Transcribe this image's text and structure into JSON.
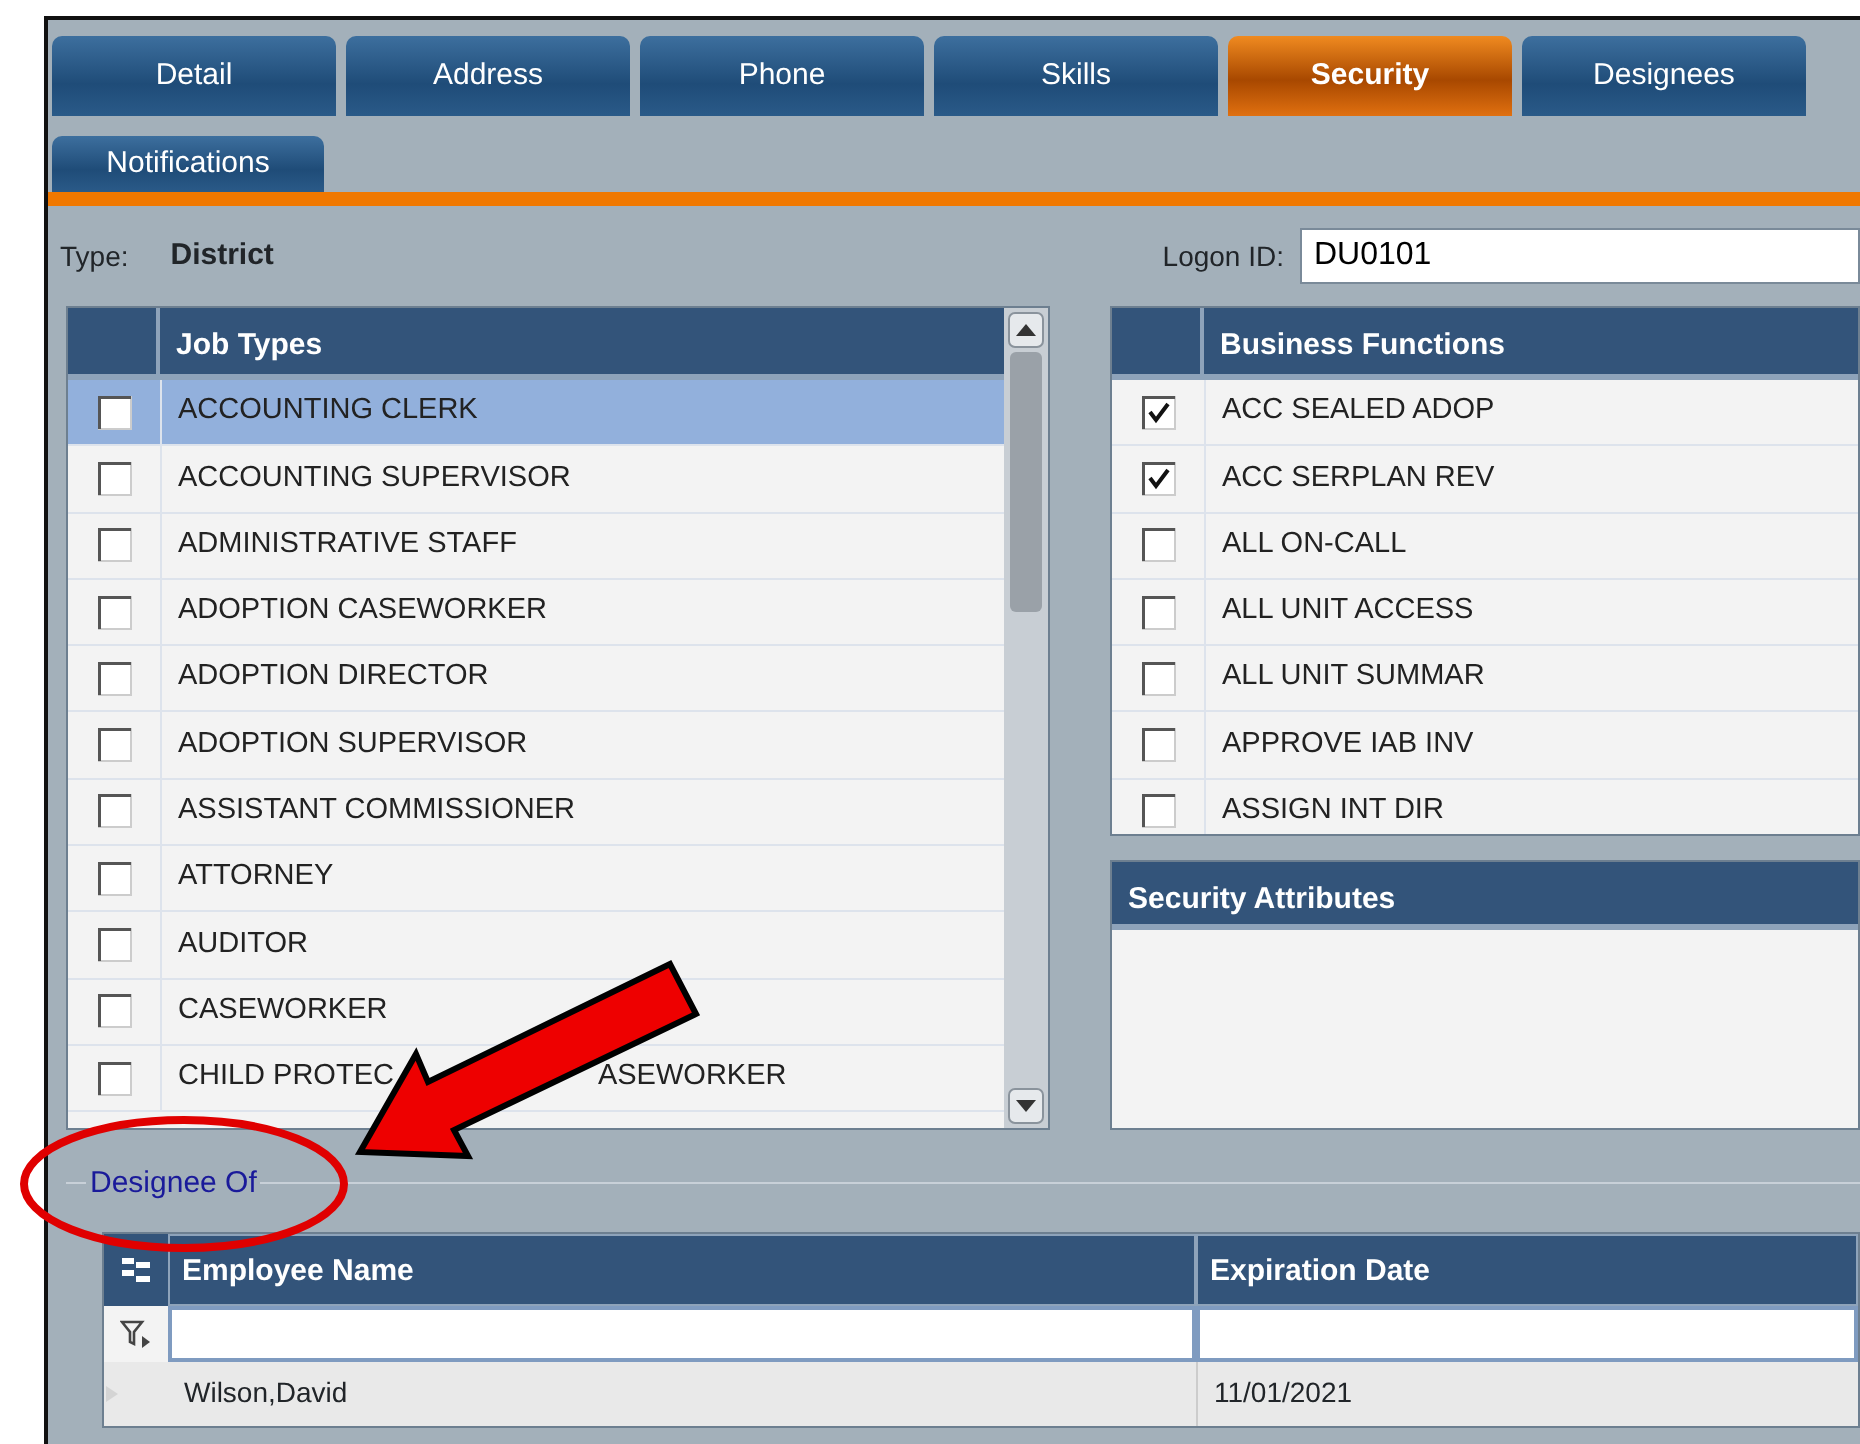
{
  "tabs": [
    {
      "label": "Detail",
      "selected": false
    },
    {
      "label": "Address",
      "selected": false
    },
    {
      "label": "Phone",
      "selected": false
    },
    {
      "label": "Skills",
      "selected": false
    },
    {
      "label": "Security",
      "selected": true
    },
    {
      "label": "Designees",
      "selected": false
    }
  ],
  "tabs_second_row": [
    {
      "label": "Notifications",
      "selected": false
    }
  ],
  "type_label": "Type:",
  "type_value": "District",
  "logon_label": "Logon ID:",
  "logon_id": "DU0101",
  "job_types": {
    "header": "Job Types",
    "rows": [
      {
        "label": "ACCOUNTING CLERK",
        "checked": false,
        "selected": true
      },
      {
        "label": "ACCOUNTING SUPERVISOR",
        "checked": false,
        "selected": false
      },
      {
        "label": "ADMINISTRATIVE STAFF",
        "checked": false,
        "selected": false
      },
      {
        "label": "ADOPTION CASEWORKER",
        "checked": false,
        "selected": false
      },
      {
        "label": "ADOPTION DIRECTOR",
        "checked": false,
        "selected": false
      },
      {
        "label": "ADOPTION SUPERVISOR",
        "checked": false,
        "selected": false
      },
      {
        "label": "ASSISTANT COMMISSIONER",
        "checked": false,
        "selected": false
      },
      {
        "label": "ATTORNEY",
        "checked": false,
        "selected": false
      },
      {
        "label": "AUDITOR",
        "checked": false,
        "selected": false
      },
      {
        "label": "CASEWORKER",
        "checked": false,
        "selected": false
      },
      {
        "label": "CHILD PROTEC",
        "label_continued": "ASEWORKER",
        "checked": false,
        "selected": false
      }
    ]
  },
  "business_functions": {
    "header": "Business Functions",
    "rows": [
      {
        "label": "ACC SEALED ADOP",
        "checked": true
      },
      {
        "label": "ACC SERPLAN REV",
        "checked": true
      },
      {
        "label": "ALL ON-CALL",
        "checked": false
      },
      {
        "label": "ALL UNIT ACCESS",
        "checked": false
      },
      {
        "label": "ALL UNIT SUMMAR",
        "checked": false
      },
      {
        "label": "APPROVE IAB INV",
        "checked": false
      },
      {
        "label": "ASSIGN INT DIR",
        "checked": false
      }
    ]
  },
  "security_attributes": {
    "header": "Security Attributes"
  },
  "designee_of": {
    "title": "Designee Of",
    "columns": [
      "Employee Name",
      "Expiration Date"
    ],
    "rows": [
      [
        "Wilson,David",
        "11/01/2021"
      ]
    ]
  }
}
